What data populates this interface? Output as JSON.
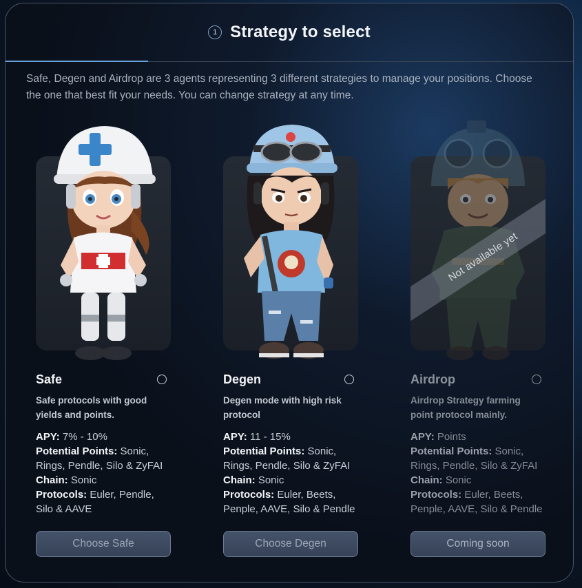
{
  "header": {
    "step": "1",
    "title": "Strategy to select"
  },
  "intro": "Safe, Degen and Airdrop are 3 agents representing 3 different strategies to manage your positions. Choose the one that best fit your needs. You can change strategy at any time.",
  "cards": [
    {
      "name": "Safe",
      "avatar_icon": "nurse-helmet-girl-avatar",
      "description": "Safe protocols with good yields and points.",
      "apy_label": "APY:",
      "apy": " 7% - 10%",
      "points_label": "Potential Points:",
      "points": " Sonic, Rings, Pendle, Silo & ZyFAI",
      "chain_label": "Chain:",
      "chain": " Sonic",
      "protocols_label": "Protocols:",
      "protocols": " Euler, Pendle, Silo & AAVE",
      "button": "Choose Safe"
    },
    {
      "name": "Degen",
      "avatar_icon": "goggles-cap-boy-avatar",
      "description": "Degen mode with high risk protocol",
      "apy_label": "APY:",
      "apy": " 11 - 15%",
      "points_label": "Potential Points:",
      "points": " Sonic, Rings, Pendle, Silo & ZyFAI",
      "chain_label": "Chain:",
      "chain": " Sonic",
      "protocols_label": "Protocols:",
      "protocols": " Euler, Beets, Penple, AAVE, Silo & Pendle",
      "button": "Choose Degen"
    },
    {
      "name": "Airdrop",
      "avatar_icon": "pilot-helmet-avatar",
      "ribbon": "Not available yet",
      "description": "Airdrop Strategy farming point protocol mainly.",
      "apy_label": "APY:",
      "apy": " Points",
      "points_label": "Potential Points:",
      "points": " Sonic, Rings, Pendle, Silo & ZyFAI",
      "chain_label": "Chain:",
      "chain": " Sonic",
      "protocols_label": "Protocols:",
      "protocols": " Euler, Beets, Penple, AAVE, Silo & Pendle",
      "button": "Coming soon"
    }
  ],
  "colors": {
    "accent": "#6aa0d8",
    "button_bg": "#3e4a60",
    "panel_border": "#4a5566"
  }
}
